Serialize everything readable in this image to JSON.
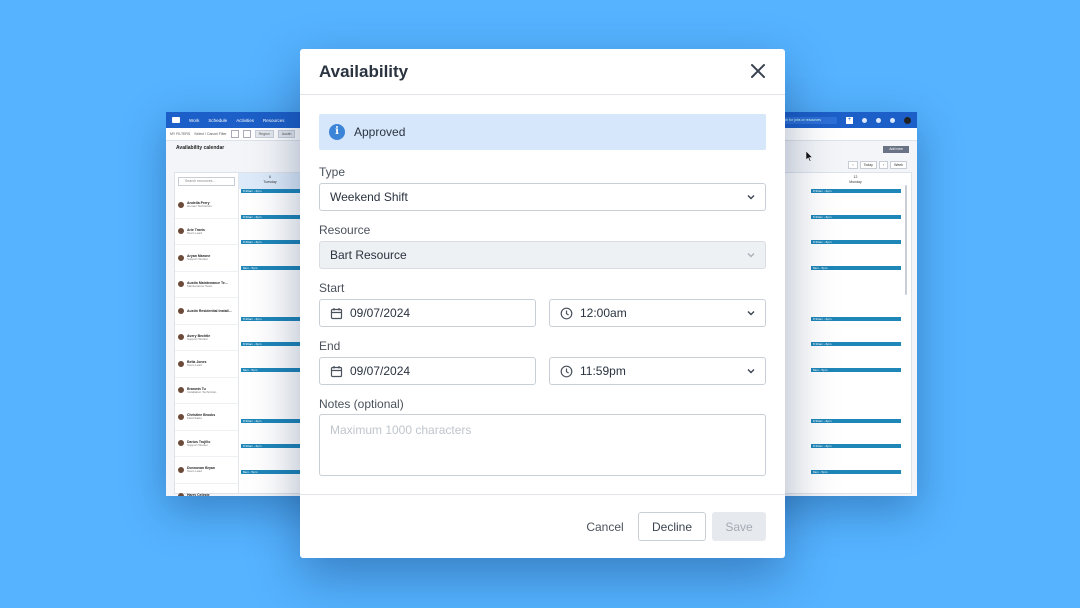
{
  "background_app": {
    "nav": [
      "Work",
      "Schedule",
      "Activities",
      "Resources"
    ],
    "search_placeholder": "Search for jobs or resources",
    "filter_label": "MY FILTERS",
    "filter_value": "Select / Cancel Filter",
    "chips": [
      "Region",
      "Austin"
    ],
    "page_title": "Availability calendar",
    "add_button": "Add new",
    "nav_today": "Today",
    "nav_week": "Week",
    "resource_search": "Search resources...",
    "day_left": {
      "num": "6",
      "name": "Tuesday"
    },
    "day_right": {
      "num": "12",
      "name": "Monday"
    },
    "resources": [
      {
        "name": "Andella Perry",
        "role": "Human Technician"
      },
      {
        "name": "Arie Travis",
        "role": "Team Lead"
      },
      {
        "name": "Aryan Marone",
        "role": "Support Worker"
      },
      {
        "name": "Austin Maintenance Te...",
        "role": "Maintenance Team"
      },
      {
        "name": "Austin Residential Install...",
        "role": ""
      },
      {
        "name": "Avery Bechtle",
        "role": "Support Worker"
      },
      {
        "name": "Bella Jones",
        "role": "Team Lead"
      },
      {
        "name": "Branwin Tu",
        "role": "Installation Technician"
      },
      {
        "name": "Christine Brooks",
        "role": "Field Sales"
      },
      {
        "name": "Darius Trujillo",
        "role": "Support Worker"
      },
      {
        "name": "Donnovan Bryan",
        "role": "Team Lead"
      },
      {
        "name": "Harry Celeste",
        "role": "Installation Technician"
      }
    ],
    "shift_left": [
      "8:30am - 6pm",
      "8:30am - 6pm",
      "8:30am - 6pm",
      "8am - 5pm",
      "",
      "8:30am - 6pm",
      "8:30am - 6pm",
      "8am - 5pm",
      "",
      "8:30am - 6pm",
      "8:30am - 6pm",
      "8am - 5pm"
    ],
    "shift_right": [
      "8:30am - 6pm",
      "8:30am - 6pm",
      "8:30am - 6pm",
      "8am - 5pm",
      "",
      "8:30am - 6pm",
      "8:30am - 6pm",
      "8am - 5pm",
      "",
      "8:30am - 6pm",
      "8:30am - 6pm",
      "8am - 5pm"
    ]
  },
  "modal": {
    "title": "Availability",
    "status": "Approved",
    "type_label": "Type",
    "type_value": "Weekend Shift",
    "resource_label": "Resource",
    "resource_value": "Bart Resource",
    "start_label": "Start",
    "start_date": "09/07/2024",
    "start_time": "12:00am",
    "end_label": "End",
    "end_date": "09/07/2024",
    "end_time": "11:59pm",
    "notes_label": "Notes (optional)",
    "notes_placeholder": "Maximum 1000 characters",
    "cancel_label": "Cancel",
    "decline_label": "Decline",
    "save_label": "Save"
  },
  "colors": {
    "page_bg": "#55b3ff",
    "app_header": "#1c5fc8",
    "alert_bg": "#d6e7fb",
    "info_icon": "#3c84d8",
    "shift": "#1f86b8"
  },
  "icons": [
    "logo-icon",
    "info-icon",
    "close-icon",
    "chevron-down-icon",
    "calendar-icon",
    "clock-icon"
  ]
}
